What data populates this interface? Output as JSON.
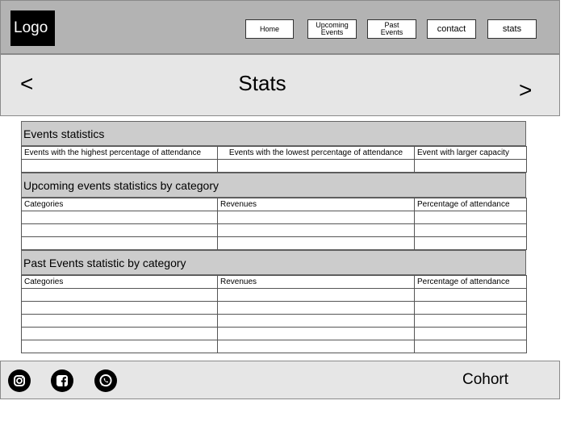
{
  "header": {
    "logo": "Logo",
    "nav": [
      {
        "label": "Home"
      },
      {
        "label": "Upcoming\nEvents"
      },
      {
        "label": "Past\nEvents"
      },
      {
        "label": "contact"
      },
      {
        "label": "stats"
      }
    ]
  },
  "banner": {
    "prev": "<",
    "title": "Stats",
    "next": ">"
  },
  "events_statistics": {
    "title": "Events statistics",
    "headers": [
      "Events with the highest percentage of attendance",
      "Events with the lowest percentage of attendance",
      "Event with larger capacity"
    ]
  },
  "upcoming_statistics": {
    "title": "Upcoming events statistics by category",
    "headers": [
      "Categories",
      "Revenues",
      "Percentage of attendance"
    ]
  },
  "past_statistics": {
    "title": "Past Events statistic by category",
    "headers": [
      "Categories",
      "Revenues",
      "Percentage of attendance"
    ]
  },
  "footer": {
    "social": [
      "instagram-icon",
      "facebook-icon",
      "whatsapp-icon"
    ],
    "cohort": "Cohort"
  }
}
